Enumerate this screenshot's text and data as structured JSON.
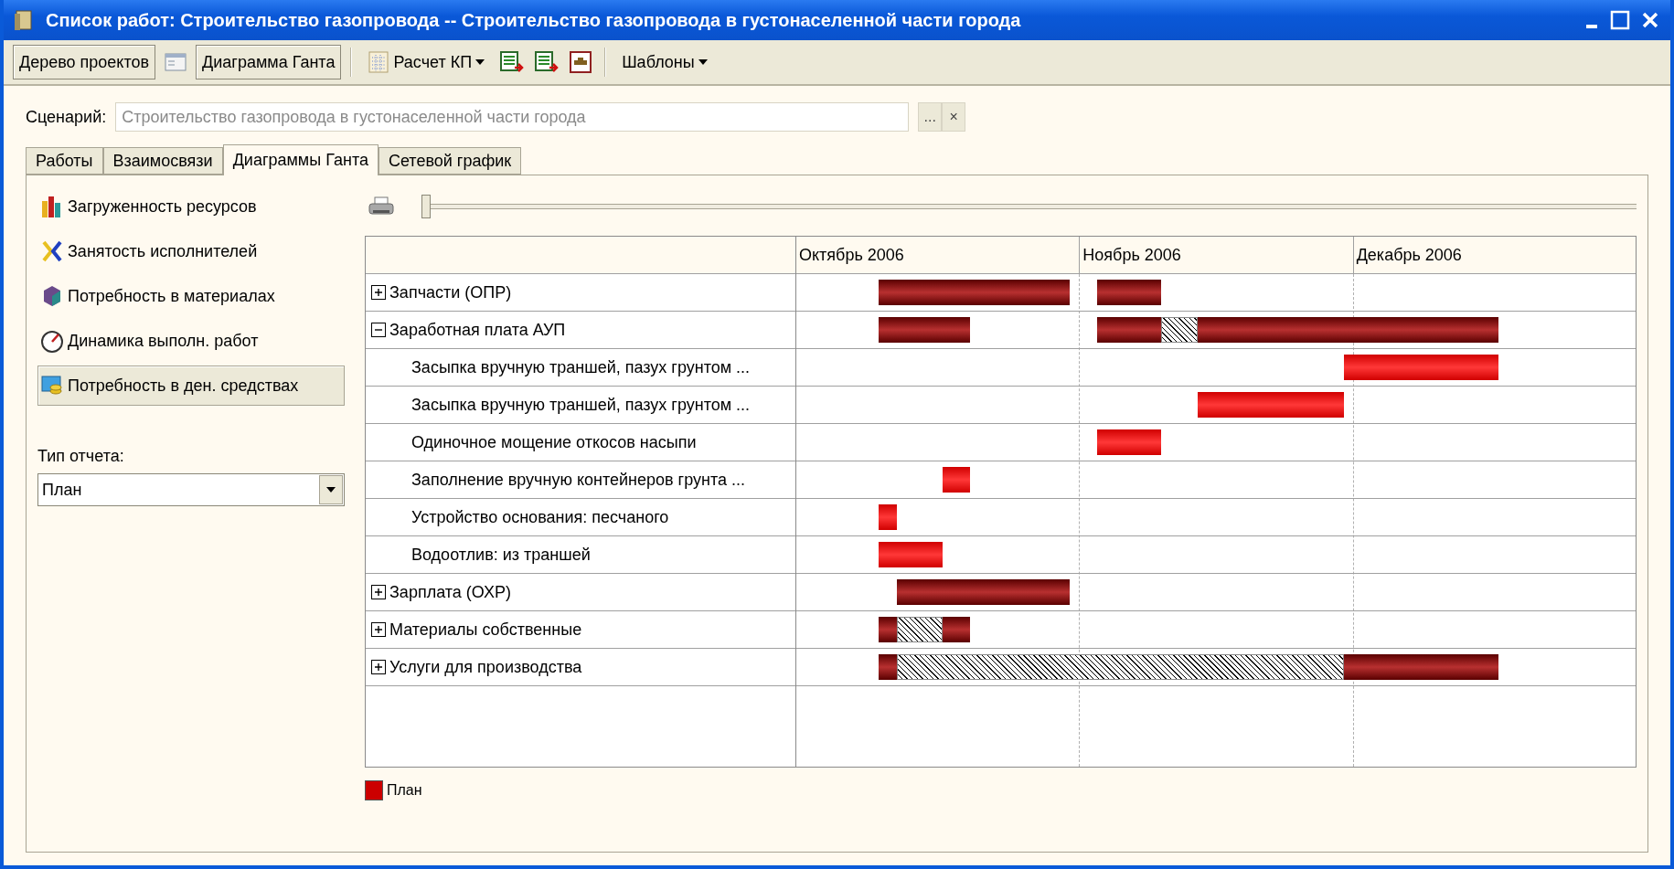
{
  "window": {
    "title": "Список работ: Строительство газопровода -- Строительство газопровода в густонаселенной части города"
  },
  "toolbar": {
    "project_tree": "Дерево проектов",
    "gantt": "Диаграмма Ганта",
    "calc": "Расчет КП",
    "templates": "Шаблоны"
  },
  "scenario": {
    "label": "Сценарий:",
    "value": "Строительство газопровода в густонаселенной части города",
    "select_button": "...",
    "clear_button": "×"
  },
  "tabs": [
    {
      "label": "Работы",
      "selected": false
    },
    {
      "label": "Взаимосвязи",
      "selected": false
    },
    {
      "label": "Диаграммы Ганта",
      "selected": true
    },
    {
      "label": "Сетевой график",
      "selected": false
    }
  ],
  "reports": [
    {
      "label": "Загруженность ресурсов",
      "selected": false
    },
    {
      "label": "Занятость исполнителей",
      "selected": false
    },
    {
      "label": "Потребность в материалах",
      "selected": false
    },
    {
      "label": "Динамика выполн. работ",
      "selected": false
    },
    {
      "label": "Потребность в ден. средствах",
      "selected": true
    }
  ],
  "report_type": {
    "label": "Тип отчета:",
    "value": "План"
  },
  "zoom_slider": {
    "level": 0
  },
  "gantt": {
    "rows": [
      {
        "label": "Запчасти (ОПР)",
        "expanded": false
      },
      {
        "label": "Заработная плата АУП",
        "expanded": true,
        "children": [
          {
            "label": "Засыпка вручную траншей, пазух грунтом ..."
          },
          {
            "label": "Засыпка вручную траншей, пазух грунтом ..."
          },
          {
            "label": "Одиночное мощение откосов насыпи"
          },
          {
            "label": "Заполнение вручную контейнеров грунта ..."
          },
          {
            "label": "Устройство основания:  песчаного"
          },
          {
            "label": "Водоотлив:  из траншей"
          }
        ]
      },
      {
        "label": "Зарплата (ОХР)",
        "expanded": false
      },
      {
        "label": "Материалы собственные",
        "expanded": false
      },
      {
        "label": "Услуги для производства",
        "expanded": false
      }
    ],
    "months": [
      "Октябрь 2006",
      "Ноябрь 2006",
      "Декабрь 2006"
    ]
  },
  "legend": [
    {
      "label": "План",
      "color": "#cc0000"
    }
  ]
}
